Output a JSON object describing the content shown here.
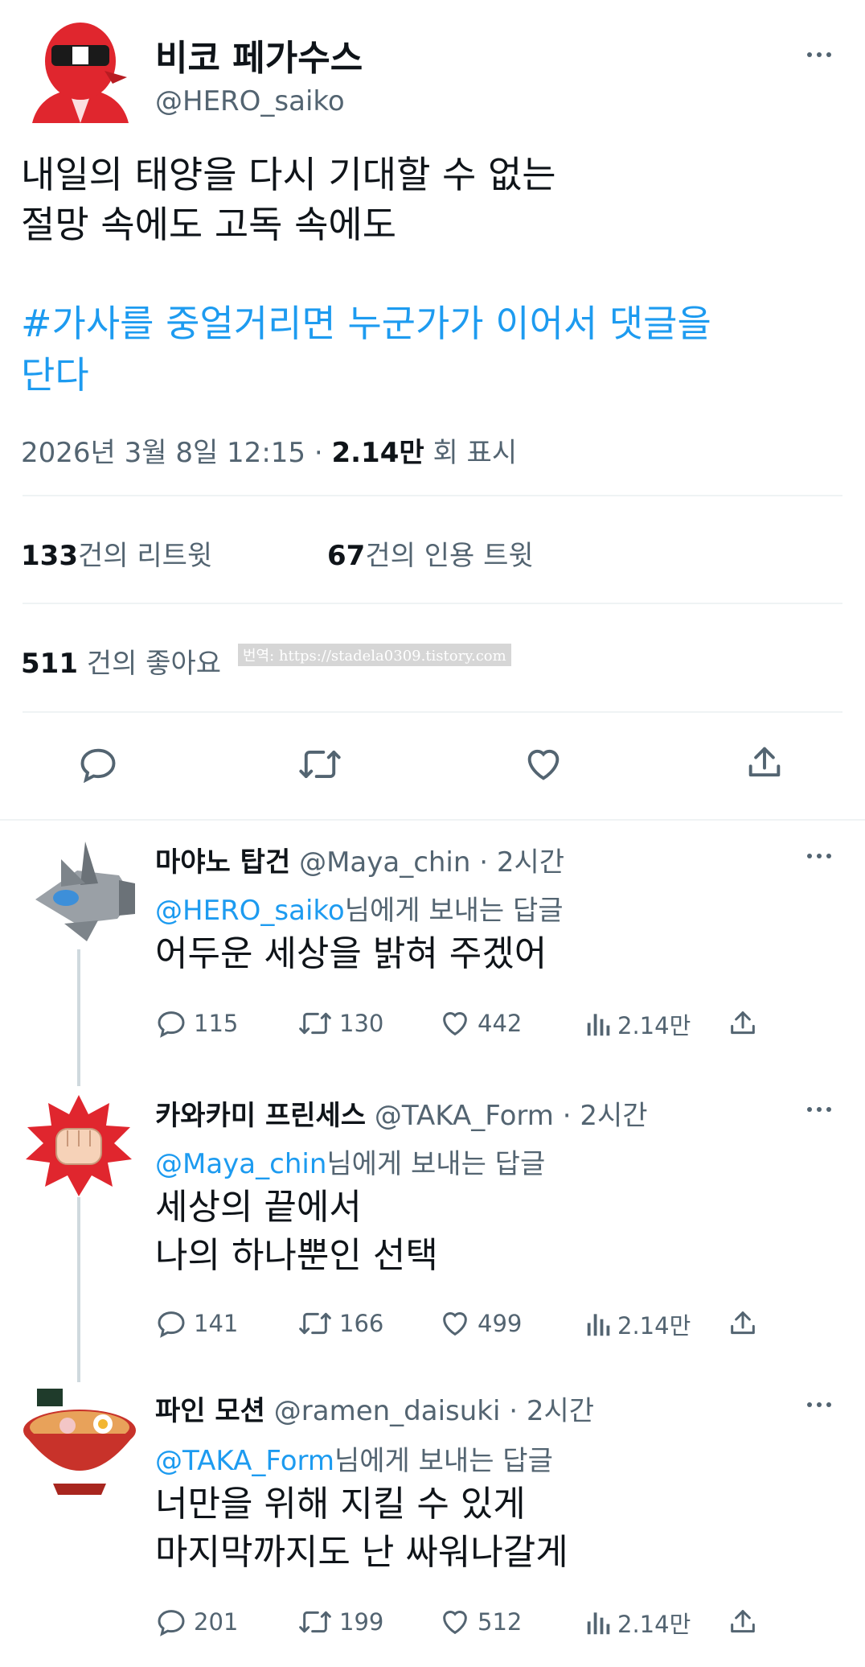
{
  "main_tweet": {
    "display_name": "비코 페가수스",
    "handle": "@HERO_saiko",
    "text_lines": [
      "내일의 태양을 다시 기대할 수 없는",
      "절망 속에도 고독 속에도"
    ],
    "hashtag_lines": [
      "#가사를 중얼거리면 누군가가 이어서 댓글을",
      "단다"
    ],
    "timestamp": "2026년 3월 8일 12:15",
    "separator": "·",
    "views_count": "2.14만",
    "views_label": "회 표시",
    "retweets_count": "133",
    "retweets_label": "건의 리트윗",
    "quotes_count": "67",
    "quotes_label": "건의 인용 트윗",
    "likes_count": "511",
    "likes_label": "건의 좋아요",
    "watermark": "번역: https://stadela0309.tistory.com"
  },
  "replies": [
    {
      "display_name": "마야노 탑건",
      "handle": "@Maya_chin",
      "time": "· 2시간",
      "reply_to_handle": "@HERO_saiko",
      "reply_to_suffix": "님에게 보내는 답글",
      "text_lines": [
        "어두운 세상을 밝혀 주겠어"
      ],
      "replies": "115",
      "retweets": "130",
      "likes": "442",
      "views": "2.14만"
    },
    {
      "display_name": "카와카미 프린세스",
      "handle": "@TAKA_Form",
      "time": "· 2시간",
      "reply_to_handle": "@Maya_chin",
      "reply_to_suffix": "님에게 보내는 답글",
      "text_lines": [
        "세상의 끝에서",
        "나의 하나뿐인 선택"
      ],
      "replies": "141",
      "retweets": "166",
      "likes": "499",
      "views": "2.14만"
    },
    {
      "display_name": "파인 모션",
      "handle": "@ramen_daisuki",
      "time": "· 2시간",
      "reply_to_handle": "@TAKA_Form",
      "reply_to_suffix": "님에게 보내는 답글",
      "text_lines": [
        "너만을 위해 지킬 수 있게",
        "마지막까지도 난 싸워나갈게"
      ],
      "replies": "201",
      "retweets": "199",
      "likes": "512",
      "views": "2.14만"
    }
  ],
  "colors": {
    "link": "#1d9bf0",
    "muted": "#536471",
    "text": "#0f1419",
    "divider": "#eff3f4"
  },
  "icons": [
    "more-icon",
    "reply-icon",
    "retweet-icon",
    "like-icon",
    "share-icon",
    "views-icon"
  ]
}
